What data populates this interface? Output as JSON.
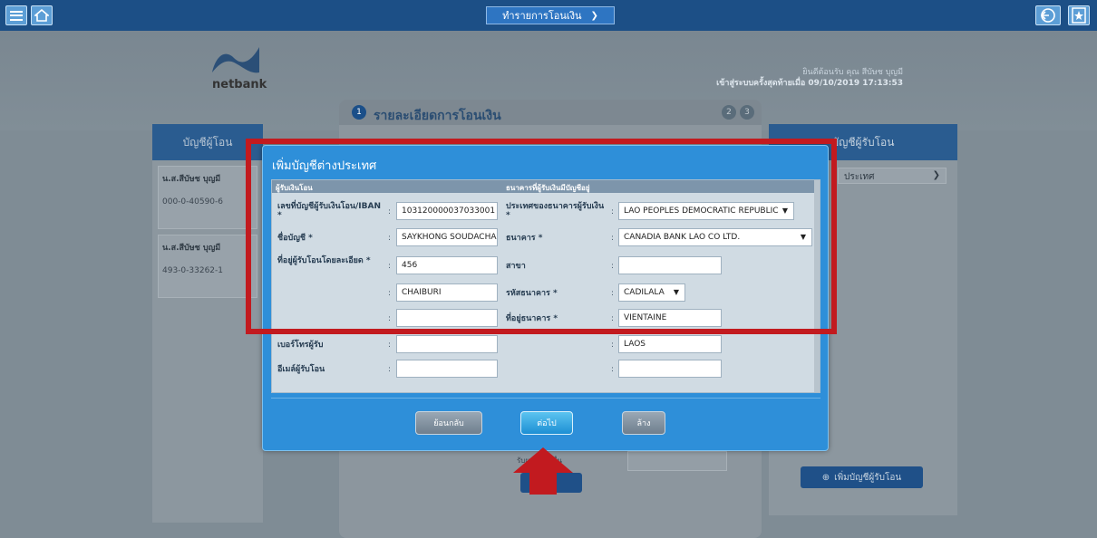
{
  "topbar": {
    "center_label": "ทำรายการโอนเงิน",
    "center_icon": "double-chevron-down-icon"
  },
  "banner": {
    "logo_text": "netbank",
    "welcome_line1": "ยินดีต้อนรับ คุณ สีบัษช บุญมี",
    "welcome_line2": "เข้าสู่ระบบครั้งสุดท้ายเมื่อ 09/10/2019 17:13:53"
  },
  "left_panel": {
    "title": "บัญชีผู้โอน",
    "accounts": [
      {
        "name": "น.ส.สีบัษช บุญมี",
        "number": "000-0-40590-6"
      },
      {
        "name": "น.ส.สีบัษช บุญมี",
        "number": "493-0-33262-1"
      }
    ]
  },
  "middle_panel": {
    "step1": "1",
    "title": "รายละเอียดการโอนเงิน",
    "step2": "2",
    "step3": "3",
    "note": "รับผลบุคคลอื่น",
    "button": "ป"
  },
  "right_panel": {
    "title": "บัญชีผู้รับโอน",
    "select_value": "ประเทศ",
    "add_button": "เพิ่มบัญชีผู้รับโอน"
  },
  "modal": {
    "title": "เพิ่มบัญชีต่างประเทศ",
    "left_header": "ผู้รับเงินโอน",
    "right_header": "ธนาคารที่ผู้รับเงินมีบัญชีอยู่",
    "fields_left": [
      {
        "label": "เลขที่บัญชีผู้รับเงินโอน/IBAN *",
        "value": "103120000037033001"
      },
      {
        "label": "ชื่อบัญชี *",
        "value": "SAYKHONG SOUDACHAN"
      },
      {
        "label": "ที่อยู่ผู้รับโอนโดยละเอียด *",
        "value": "456"
      },
      {
        "label": "",
        "value": "CHAIBURI"
      },
      {
        "label": "",
        "value": ""
      },
      {
        "label": "เบอร์โทรผู้รับ",
        "value": ""
      },
      {
        "label": "อีเมล์ผู้รับโอน",
        "value": ""
      }
    ],
    "fields_right": [
      {
        "label": "ประเทศของธนาคารผู้รับเงิน *",
        "value": "LAO PEOPLES DEMOCRATIC REPUBLIC"
      },
      {
        "label": "ธนาคาร *",
        "value": "CANADIA BANK LAO CO LTD."
      },
      {
        "label": "สาขา",
        "value": ""
      },
      {
        "label": "รหัสธนาคาร *",
        "value": "CADILALA"
      },
      {
        "label": "ที่อยู่ธนาคาร *",
        "value": "VIENTAINE"
      },
      {
        "label": "",
        "value": "LAOS"
      },
      {
        "label": "",
        "value": ""
      }
    ],
    "buttons": {
      "back": "ย้อนกลับ",
      "next": "ต่อไป",
      "clear": "ล้าง"
    }
  },
  "colors": {
    "annotation_red": "#c21a1f",
    "modal_blue": "#2e8fd9",
    "topbar": "#1c4f86"
  }
}
